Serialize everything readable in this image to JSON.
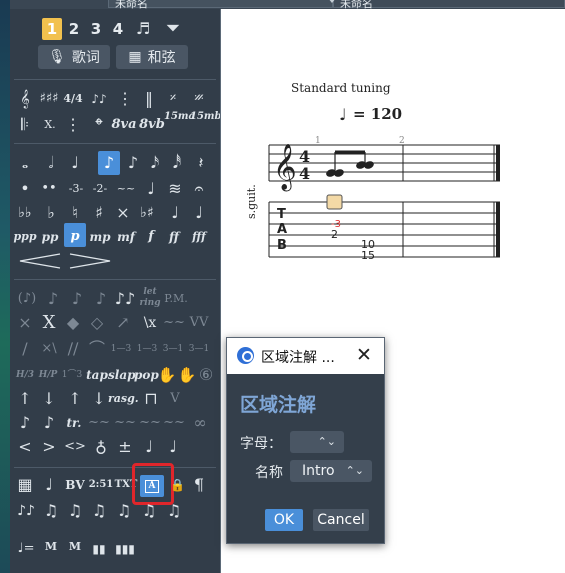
{
  "topbar": {
    "tab_a_label": "未命名",
    "tab_b_label": "未命名"
  },
  "palette": {
    "voices": [
      "1",
      "2",
      "3",
      "4"
    ],
    "lyrics_label": "歌词",
    "chords_label": "和弦",
    "row1": [
      "𝄞",
      "♯♯♯",
      "4/4",
      "♪♪",
      "⋮",
      "‖",
      "𝄎",
      "𝄏"
    ],
    "row2": [
      "𝄆",
      "X.",
      "⋮",
      "𝄌",
      "8va",
      "8vb",
      "15ma",
      "15mb"
    ],
    "row3": [
      "𝅝",
      "𝅗𝅥",
      "♩",
      "♪",
      "♪",
      "𝅘𝅥𝅯",
      "𝅘𝅥𝅰",
      "𝄽"
    ],
    "row4": [
      "•",
      "••",
      "-3-",
      "-2-",
      "~~",
      "♩",
      "≋",
      "𝄐"
    ],
    "row5": [
      "♭♭",
      "♭",
      "♮",
      "♯",
      "×",
      "♭♯",
      "♩",
      "♩"
    ],
    "dynamics": [
      "ppp",
      "pp",
      "p",
      "mp",
      "mf",
      "f",
      "ff",
      "fff"
    ],
    "row7": [
      "<",
      ">"
    ],
    "row8": [
      "(♪)",
      "♪",
      "♪",
      "♪",
      "♪♪",
      "let ring",
      "P.M."
    ],
    "row9": [
      "×",
      "X",
      "◆",
      "◇",
      "↗",
      "\\x",
      "~~",
      "VV"
    ],
    "row10": [
      "/",
      "×\\",
      "∕∕",
      "⌒",
      "1—3",
      "1—3",
      "3—1",
      "3—1"
    ],
    "row11": [
      "H/3",
      "H/P",
      "1⌒3",
      "tap",
      "slap",
      "pop",
      "✋",
      "✋",
      "⑥"
    ],
    "row12": [
      "↑",
      "↓",
      "↑",
      "↓",
      "rasg.",
      "⊓",
      "V"
    ],
    "row13": [
      "♪",
      "♪",
      "tr.",
      "~~",
      "~~",
      "~~",
      "~~",
      "∞"
    ],
    "row14": [
      "<",
      ">",
      "<>",
      "♁",
      "±",
      "♩",
      "♩"
    ],
    "row15": [
      "▦",
      "♩",
      "BV",
      "2:51",
      "TXT",
      "A",
      "🔒",
      "¶"
    ],
    "row16": [
      "♪♪",
      "♫",
      "♫",
      "♫",
      "♫",
      "♫",
      "♫"
    ],
    "row17": [
      "♩=",
      "M",
      "M",
      "▮▮",
      "▮▮▮"
    ]
  },
  "score": {
    "tuning_label": "Standard tuning",
    "tempo_value": "= 120",
    "measure_numbers": [
      "1",
      "2"
    ],
    "time_signature": [
      "4",
      "4"
    ],
    "instrument_label": "s.guit.",
    "tab_letters": [
      "T",
      "A",
      "B"
    ],
    "tab_numbers": [
      "-3",
      "2",
      "10",
      "15"
    ]
  },
  "dialog": {
    "title": "区域注解 ...",
    "heading": "区域注解",
    "letter_label": "字母：",
    "letter_value": "",
    "name_label": "名称",
    "name_value": "Intro",
    "ok_label": "OK",
    "cancel_label": "Cancel"
  },
  "colors": {
    "accent": "#4a8fd9",
    "highlight": "#e0262b",
    "voice_active": "#f2c14e"
  }
}
